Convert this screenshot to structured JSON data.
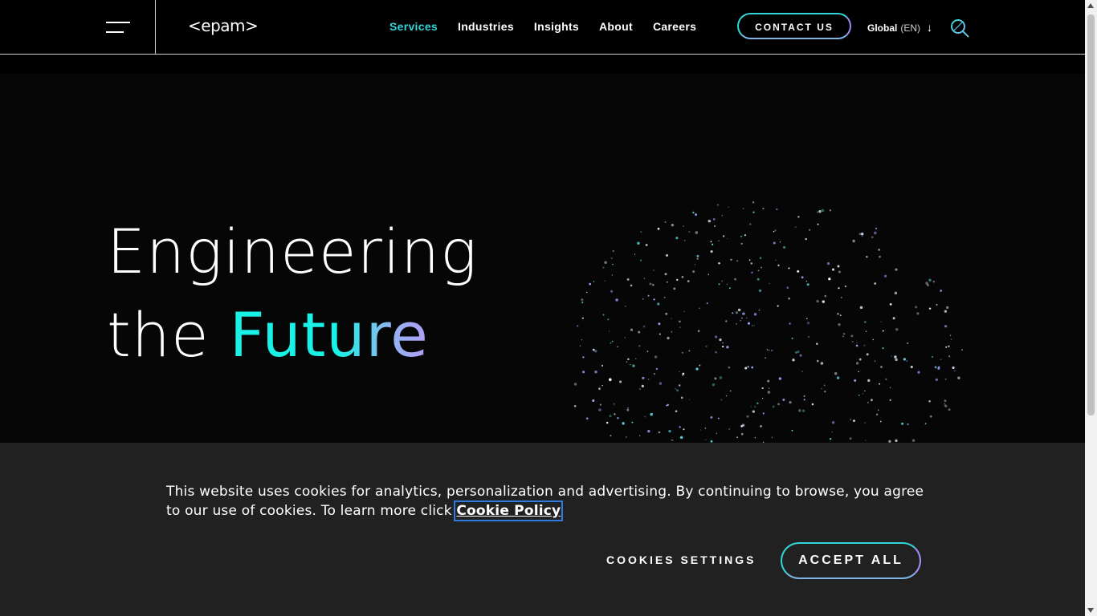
{
  "header": {
    "logo": "<epam>",
    "nav": [
      "Services",
      "Industries",
      "Insights",
      "About",
      "Careers"
    ],
    "active_nav": "Services",
    "contact_label": "CONTACT US",
    "lang_label": "Global",
    "lang_code": "(EN)",
    "accent_color": "#34d6d9"
  },
  "hero": {
    "line1": "Engineering",
    "line2_prefix": "the ",
    "line2_highlight": "Future"
  },
  "cookie": {
    "text": "This website uses cookies for analytics, personalization and advertising. By continuing to browse, you agree to our use of cookies. To learn more click ",
    "link_label": "Cookie Policy",
    "settings_label": "COOKIES SETTINGS",
    "accept_label": "ACCEPT ALL"
  },
  "icons": {
    "search": "search-icon",
    "menu": "hamburger-menu-icon",
    "lang_arrow": "arrow-down-icon"
  }
}
